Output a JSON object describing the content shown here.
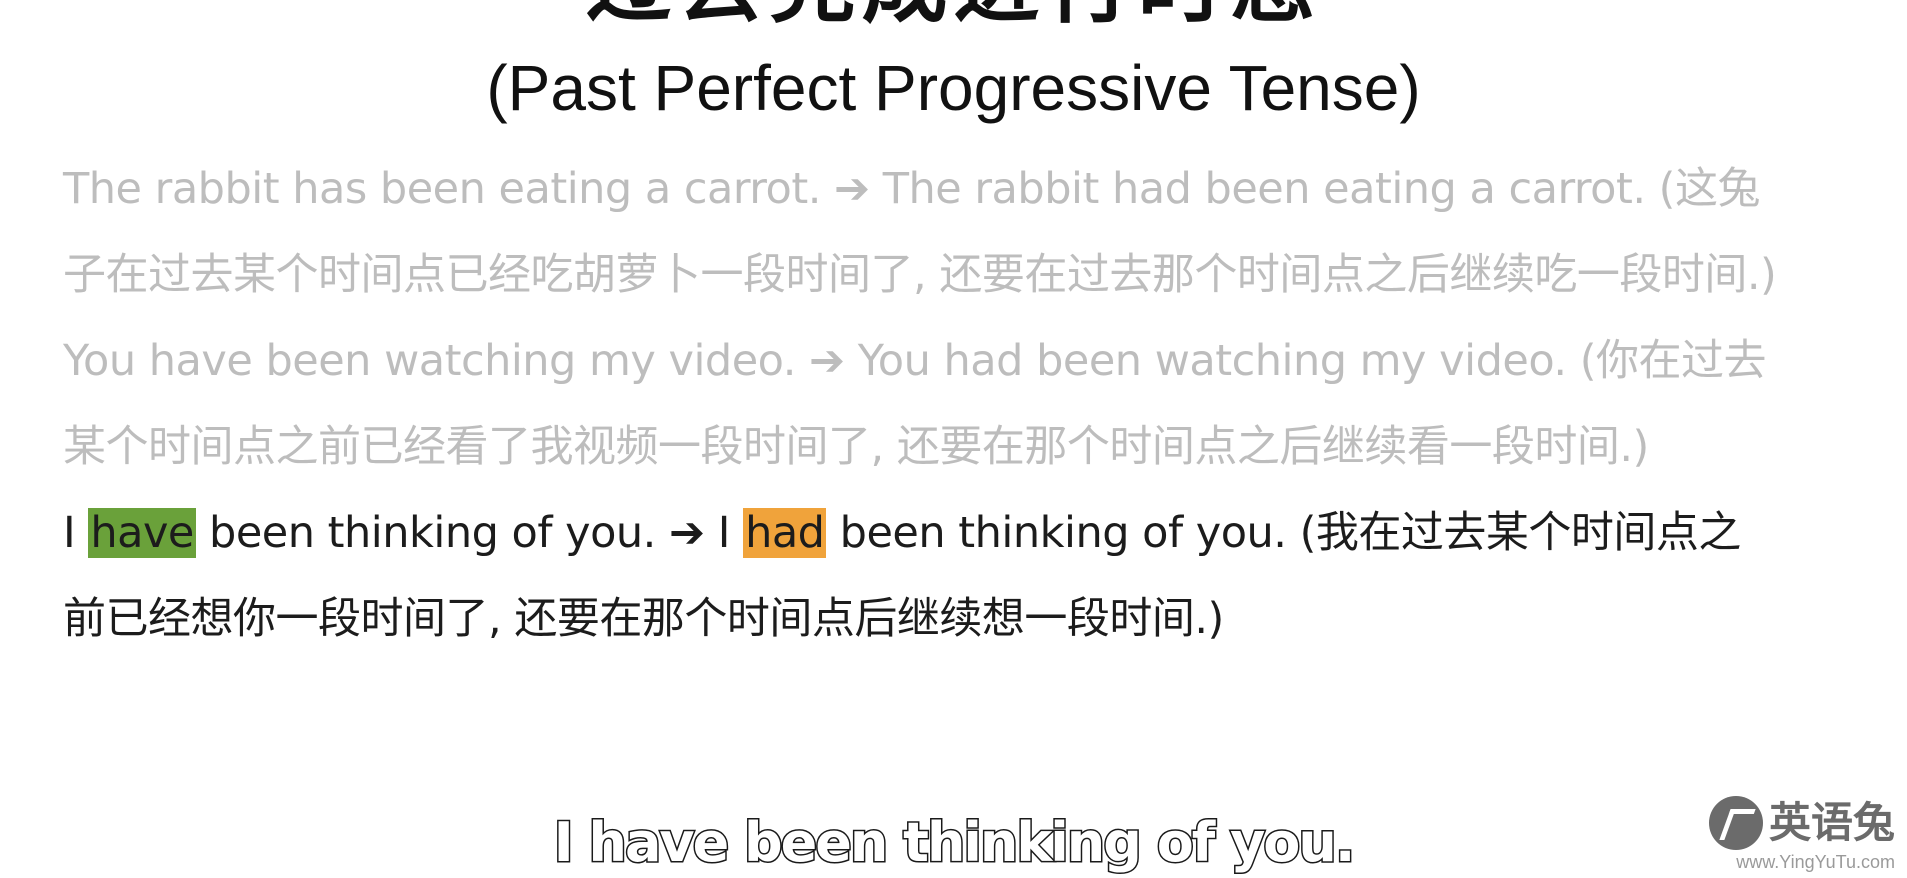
{
  "title": {
    "chinese": "过去完成进行时态",
    "english": "(Past Perfect Progressive Tense)"
  },
  "examples": [
    {
      "text": "The rabbit has been eating a carrot. ➔ The rabbit had been eating a carrot. (这兔子在过去某个时间点已经吃胡萝卜一段时间了, 还要在过去那个时间点之后继续吃一段时间.)"
    },
    {
      "text": "You have been watching my video. ➔ You had been watching my video. (你在过去某个时间点之前已经看了我视频一段时间了, 还要在那个时间点之后继续看一段时间.)"
    },
    {
      "part1": "I ",
      "highlight1": "have",
      "part2": " been thinking of you. ",
      "arrow": "➔",
      "part3": " I ",
      "highlight2": "had",
      "part4": " been thinking of you. (我在过去某个时间点之前已经想你一段时间了, 还要在那个时间点后继续想一段时间.)"
    }
  ],
  "subtitle": "I have been thinking of you.",
  "watermark": {
    "brand": "英语兔",
    "url": "www.YingYuTu.com"
  },
  "colors": {
    "highlight_have": "#6aa13a",
    "highlight_had": "#f0a33b",
    "faded_text": "#bdbdbd"
  }
}
